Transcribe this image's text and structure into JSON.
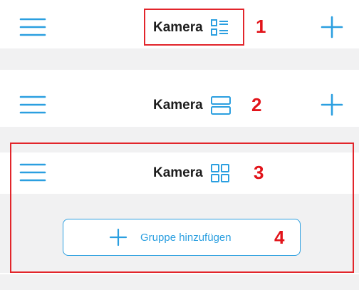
{
  "screens": [
    {
      "title": "Kamera",
      "number": "1",
      "view_icon": "list-view-icon"
    },
    {
      "title": "Kamera",
      "number": "2",
      "view_icon": "large-tile-view-icon"
    },
    {
      "title": "Kamera",
      "number": "3",
      "view_icon": "grid-view-icon"
    }
  ],
  "add_group": {
    "label": "Gruppe hinzufügen",
    "number": "4"
  },
  "colors": {
    "accent": "#2b9fe0",
    "annotation": "#e2141a",
    "background": "#f1f1f2"
  }
}
